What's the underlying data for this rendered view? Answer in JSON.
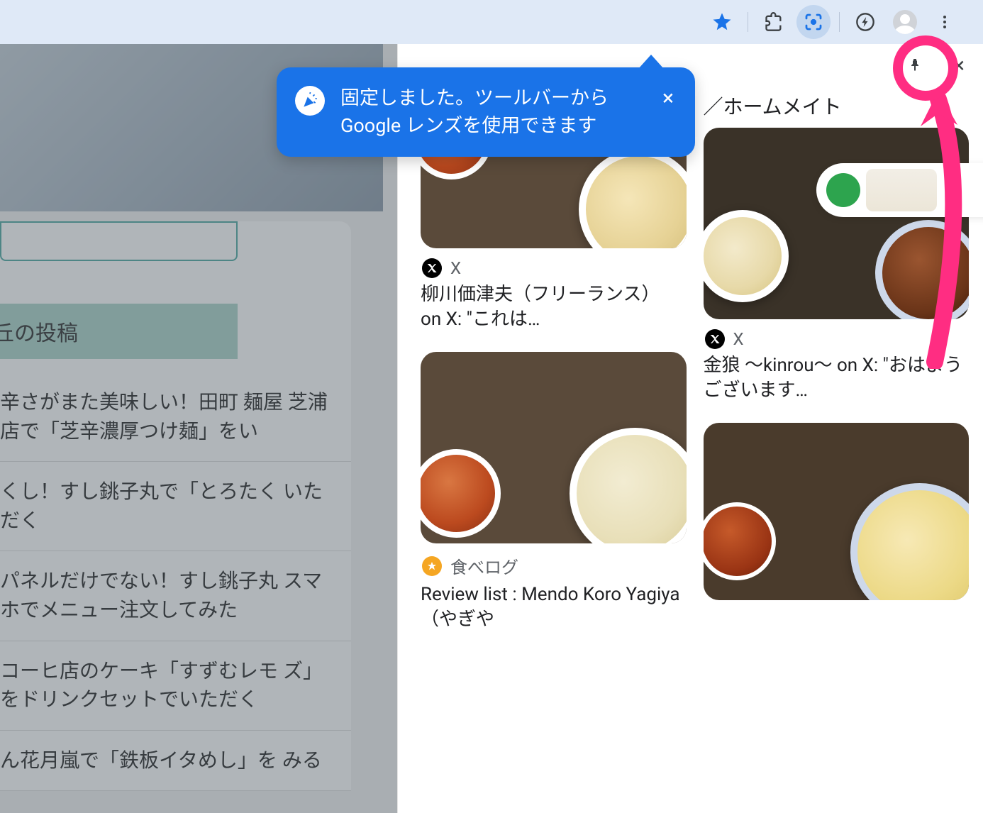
{
  "toolbar": {
    "icons": {
      "star": "star-icon",
      "extensions": "extensions-icon",
      "lens": "lens-icon",
      "assist": "circle-bolt-icon",
      "profile": "profile-avatar",
      "menu": "menu-dots-icon"
    }
  },
  "toast": {
    "message": "固定しました。ツールバーから Google レンズを使用できます",
    "close": "×"
  },
  "left": {
    "tab_label": "丘の投稿",
    "posts": [
      "辛さがまた美味しい！田町 麺屋 芝浦店で「芝辛濃厚つけ麺」をい",
      "くし！すし銚子丸で「とろたく いただく",
      "パネルだけでない！すし銚子丸 スマホでメニュー注文してみた",
      "コーヒ店のケーキ「すずむレモ ズ」をドリンクセットでいただく",
      "ん花月嵐で「鉄板イタめし」を みる"
    ]
  },
  "lens_panel": {
    "pin_icon": "pin-icon",
    "close_icon": "×"
  },
  "results": {
    "col1": [
      {
        "source_icon": "x",
        "source_label": "X",
        "title": "柳川価津夫（フリーランス）　on X: \"これは…"
      },
      {
        "source_icon": "tabelog",
        "source_label": "食べログ",
        "title": "Review list : Mendo Koro Yagiya　（やぎや"
      }
    ],
    "col2": [
      {
        "title_above": "／ホームメイト"
      },
      {
        "source_icon": "x",
        "source_label": "X",
        "title": "金狼 〜kinrou〜 on X: \"おはようございます…"
      },
      {}
    ]
  }
}
